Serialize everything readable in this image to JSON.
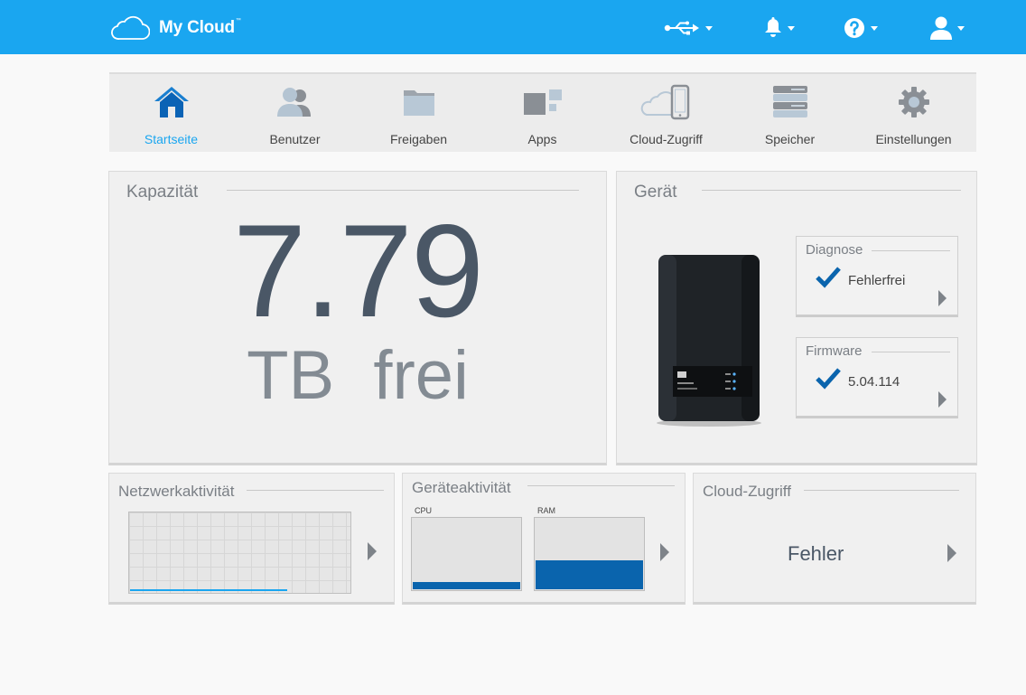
{
  "header": {
    "brand": "My Cloud",
    "brand_tm": "™",
    "buttons": [
      "usb-icon",
      "bell-icon",
      "help-icon",
      "user-icon"
    ]
  },
  "nav": {
    "items": [
      {
        "label": "Startseite",
        "icon": "home-icon",
        "active": true
      },
      {
        "label": "Benutzer",
        "icon": "users-icon",
        "active": false
      },
      {
        "label": "Freigaben",
        "icon": "folder-icon",
        "active": false
      },
      {
        "label": "Apps",
        "icon": "apps-icon",
        "active": false
      },
      {
        "label": "Cloud-Zugriff",
        "icon": "cloud-device-icon",
        "active": false
      },
      {
        "label": "Speicher",
        "icon": "storage-icon",
        "active": false
      },
      {
        "label": "Einstellungen",
        "icon": "gear-icon",
        "active": false
      }
    ]
  },
  "capacity": {
    "title": "Kapazität",
    "value": "7.79",
    "unit": "TB  frei"
  },
  "device": {
    "title": "Gerät",
    "diagnose": {
      "title": "Diagnose",
      "value": "Fehlerfrei"
    },
    "firmware": {
      "title": "Firmware",
      "value": "5.04.114"
    }
  },
  "network": {
    "title": "Netzwerkaktivität",
    "activity_fraction": 0.71
  },
  "device_activity": {
    "title": "Geräteaktivität",
    "cpu_label": "CPU",
    "ram_label": "RAM",
    "cpu_fraction": 0.1,
    "ram_fraction": 0.4
  },
  "cloud_access": {
    "title": "Cloud-Zugriff",
    "status": "Fehler"
  },
  "colors": {
    "header": "#1aa6f0",
    "accent": "#1aa6f0",
    "meter_fill": "#0a64ad",
    "check": "#0a64ad"
  }
}
